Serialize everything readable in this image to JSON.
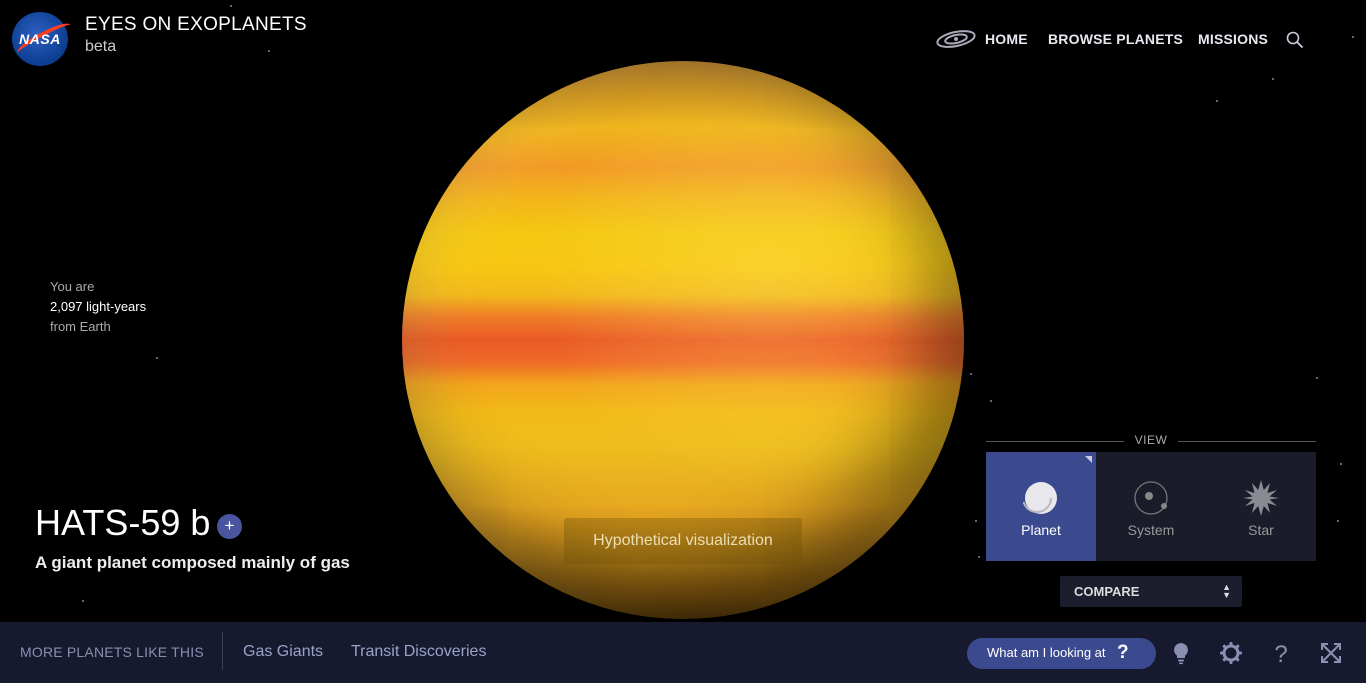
{
  "header": {
    "logo_text": "NASA",
    "title": "EYES ON EXOPLANETS",
    "subtitle": "beta",
    "nav": [
      {
        "label": "HOME"
      },
      {
        "label": "BROWSE PLANETS"
      },
      {
        "label": "MISSIONS"
      }
    ]
  },
  "distance": {
    "line1": "You are",
    "line2": "2,097 light-years",
    "line3": "from Earth"
  },
  "planet": {
    "name": "HATS-59 b",
    "description": "A giant planet composed mainly of gas",
    "add_label": "+",
    "visualization_note": "Hypothetical visualization"
  },
  "view": {
    "label": "VIEW",
    "options": [
      {
        "label": "Planet",
        "active": true
      },
      {
        "label": "System",
        "active": false
      },
      {
        "label": "Star",
        "active": false
      }
    ],
    "compare_label": "COMPARE"
  },
  "bottom_bar": {
    "more_label": "MORE PLANETS LIKE THIS",
    "links": [
      {
        "label": "Gas Giants"
      },
      {
        "label": "Transit Discoveries"
      }
    ],
    "what_label": "What am I looking at",
    "what_icon": "?"
  },
  "colors": {
    "accent": "#3b4a8f",
    "bottom_bar": "#171a2e",
    "panel": "#1a1c2a"
  }
}
